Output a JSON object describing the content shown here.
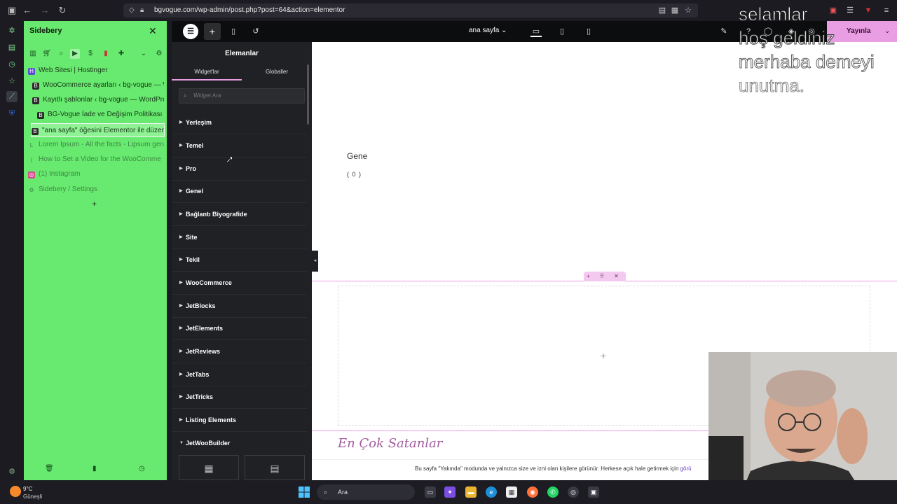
{
  "browser": {
    "url": "bgvogue.com/wp-admin/post.php?post=64&action=elementor",
    "nav": {
      "back": "←",
      "forward": "→",
      "reload": "↻"
    }
  },
  "sidebery": {
    "title": "Sidebery",
    "close": "✕",
    "tabs": [
      {
        "label": "Web Sitesi | Hostinger",
        "indent": 0,
        "state": "normal",
        "icon": "H"
      },
      {
        "label": "WooCommerce ayarları ‹ bg-vogue — W",
        "indent": 1,
        "state": "normal",
        "icon": "B"
      },
      {
        "label": "Kayıtlı şablonlar ‹ bg-vogue — WordPre",
        "indent": 1,
        "state": "normal",
        "icon": "B"
      },
      {
        "label": "BG-Vogue İade ve Değişim Politikası –",
        "indent": 2,
        "state": "normal",
        "icon": "B"
      },
      {
        "label": "\"ana sayfa\" öğesini Elementor ile düzen",
        "indent": 1,
        "state": "active",
        "icon": "B"
      },
      {
        "label": "Lorem Ipsum - All the facts - Lipsum gen",
        "indent": 0,
        "state": "faded",
        "icon": "L"
      },
      {
        "label": "How to Set a Video for the WooComme",
        "indent": 0,
        "state": "faded",
        "icon": "("
      },
      {
        "label": "(1) Instagram",
        "indent": 0,
        "state": "faded",
        "icon": "◎"
      },
      {
        "label": "Sidebery / Settings",
        "indent": 0,
        "state": "faded",
        "icon": "⚙"
      }
    ],
    "add": "+"
  },
  "elementor": {
    "page_name": "ana sayfa",
    "publish": "Yayınla",
    "panel": {
      "title": "Elemanlar",
      "tabs": [
        "Widget'lar",
        "Globaller"
      ],
      "search_placeholder": "Widget Ara",
      "categories": [
        "Yerleşim",
        "Temel",
        "Pro",
        "Genel",
        "Bağlantı Biyografide",
        "Site",
        "Tekil",
        "WooCommerce",
        "JetBlocks",
        "JetElements",
        "JetReviews",
        "JetTabs",
        "JetTricks",
        "Listing Elements",
        "JetWooBuilder"
      ],
      "open_category": "JetWooBuilder"
    },
    "canvas": {
      "heading": "Gene",
      "count": "( 0 )",
      "bestsellers": "En Çok Satanlar",
      "notice": "Bu sayfa \"Yakında\" modunda ve yalnızca size ve izni olan kişilere görünür. Herkese açık hale getirmek için ",
      "notice_link": "görü",
      "drop_plus": "+",
      "section_handle": "+ ⠿ ✕"
    }
  },
  "overlay_text": [
    "selamlar",
    "hoş geldiniz",
    "merhaba demeyi",
    "unutma."
  ],
  "taskbar": {
    "temperature": "9°C",
    "condition": "Güneşli",
    "search": "Ara"
  }
}
